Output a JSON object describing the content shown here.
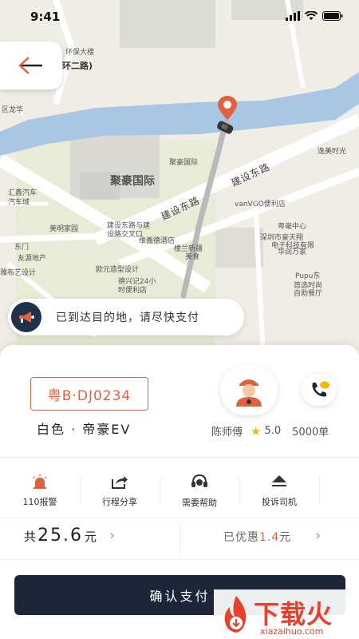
{
  "status_bar": {
    "time": "9:41"
  },
  "map": {
    "labels": {
      "huanbao": "环保大楼",
      "ring_road": "环二路)",
      "longhua": "区龙华",
      "juhao_small": "聚豪国际",
      "juhao_big": "聚豪国际",
      "yimei": "逸美时光",
      "jianshe_east": "建设东路",
      "jianshe_west": "建设东路",
      "huixin": "汇鑫汽车",
      "huixin2": "汽车城",
      "vanguo": "vanVGO便利店",
      "jianshe_post": "建设东路与建",
      "jianshe_post2": "设路交叉口",
      "yuehao": "粤毫中心",
      "meiming": "美明家园",
      "weiyi": "维義德酒店",
      "haotian": "深圳市豪天翔",
      "haotian2": "电子科技有限",
      "lilan": "楼兰新疆",
      "lilan2": "美食",
      "huarun": "华润万家",
      "dongmen": "东门",
      "youyuan": "友源地产",
      "ouyuan": "欧元造型设计",
      "yaxi": "雅布艺设计",
      "debao": "德兴记24小",
      "debao2": "时便利店",
      "pupu": "Pupu东",
      "shouchao": "首选时尚",
      "shouchao2": "自助餐厅"
    }
  },
  "back_button": {
    "icon": "back-arrow-icon"
  },
  "arrived_banner": {
    "text": "已到达目的地，请尽快支付"
  },
  "vehicle": {
    "plate": "粤B·DJ0234",
    "model": "白色 · 帝豪EV"
  },
  "driver": {
    "name": "陈师傅",
    "rating": "5.0",
    "orders": "5000单"
  },
  "actions": [
    {
      "label": "110报警",
      "icon": "alarm-icon"
    },
    {
      "label": "行程分享",
      "icon": "share-icon"
    },
    {
      "label": "需要帮助",
      "icon": "headset-icon"
    },
    {
      "label": "投诉司机",
      "icon": "complaint-icon"
    }
  ],
  "fare": {
    "prefix": "共",
    "amount": "25.6",
    "unit": "元",
    "discount_prefix": "已优惠",
    "discount": "1.4",
    "discount_unit": "元"
  },
  "confirm": {
    "label": "确认支付"
  },
  "watermark": {
    "text": "下载火",
    "url": "xiazaihuo.com"
  },
  "colors": {
    "accent": "#e0603f",
    "dark": "#1d2539",
    "water": "#a9c6e3",
    "star": "#f5b70a"
  }
}
